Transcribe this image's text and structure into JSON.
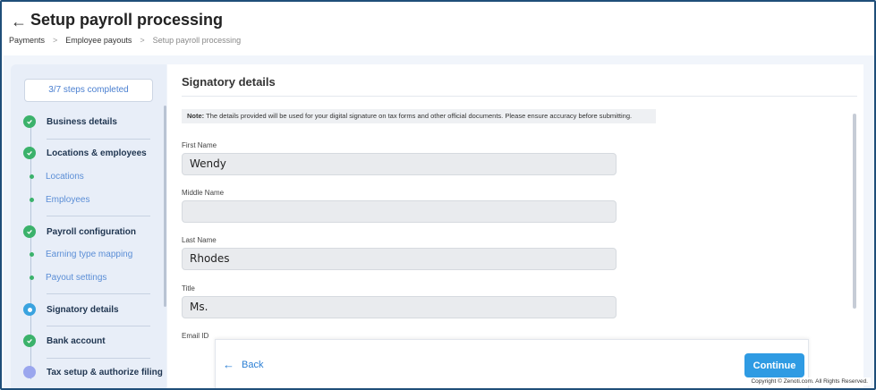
{
  "header": {
    "back_icon": "arrow-left-icon",
    "title": "Setup payroll processing",
    "breadcrumb": [
      "Payments",
      "Employee payouts",
      "Setup payroll processing"
    ],
    "breadcrumb_separator": ">"
  },
  "sidebar": {
    "progress": "3/7 steps completed",
    "steps": {
      "business": "Business details",
      "locations_employees": "Locations & employees",
      "locations": "Locations",
      "employees": "Employees",
      "payroll_config": "Payroll configuration",
      "earning_mapping": "Earning type mapping",
      "payout_settings": "Payout settings",
      "signatory": "Signatory details",
      "bank": "Bank account",
      "tax": "Tax setup & authorize filing"
    }
  },
  "main": {
    "section_title": "Signatory details",
    "note_label": "Note:",
    "note_text": "The details provided will be used for your digital signature on tax forms and other official documents. Please ensure accuracy before submitting.",
    "fields": {
      "first_name_label": "First Name",
      "first_name_value": "Wendy",
      "middle_name_label": "Middle Name",
      "middle_name_value": "",
      "last_name_label": "Last Name",
      "last_name_value": "Rhodes",
      "title_label": "Title",
      "title_value": "Ms.",
      "email_label": "Email ID"
    }
  },
  "footer": {
    "back_label": "Back",
    "continue_label": "Continue",
    "copyright": "Copyright © Zenoti.com. All Rights Reserved."
  },
  "colors": {
    "accent": "#2f9be3",
    "complete": "#3bb26b",
    "active": "#3aa3df",
    "pending": "#9aa6ee"
  }
}
